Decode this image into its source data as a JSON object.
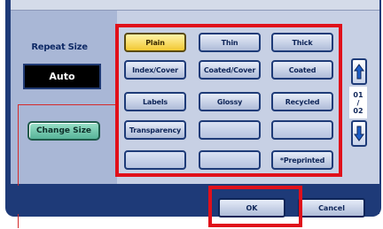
{
  "left_panel": {
    "label": "Repeat Size",
    "display_value": "Auto",
    "change_size_label": "Change Size"
  },
  "paper_types": [
    {
      "label": "Plain",
      "selected": true
    },
    {
      "label": "Thin",
      "selected": false
    },
    {
      "label": "Thick",
      "selected": false
    },
    {
      "label": "Index/Cover",
      "selected": false
    },
    {
      "label": "Coated/Cover",
      "selected": false
    },
    {
      "label": "Coated",
      "selected": false
    },
    {
      "label": "Labels",
      "selected": false
    },
    {
      "label": "Glossy",
      "selected": false
    },
    {
      "label": "Recycled",
      "selected": false
    },
    {
      "label": "Transparency",
      "selected": false
    },
    {
      "label": "",
      "selected": false
    },
    {
      "label": "",
      "selected": false
    },
    {
      "label": "",
      "selected": false
    },
    {
      "label": "",
      "selected": false
    },
    {
      "label": "*Preprinted",
      "selected": false
    }
  ],
  "pager": {
    "up_icon": "arrow-up-icon",
    "down_icon": "arrow-down-icon",
    "current": "01",
    "separator": "/",
    "total": "02"
  },
  "footer": {
    "ok_label": "OK",
    "cancel_label": "Cancel"
  },
  "colors": {
    "selected_button": "#f2c832",
    "highlight_box": "#e0101a",
    "frame": "#1e3a78"
  }
}
